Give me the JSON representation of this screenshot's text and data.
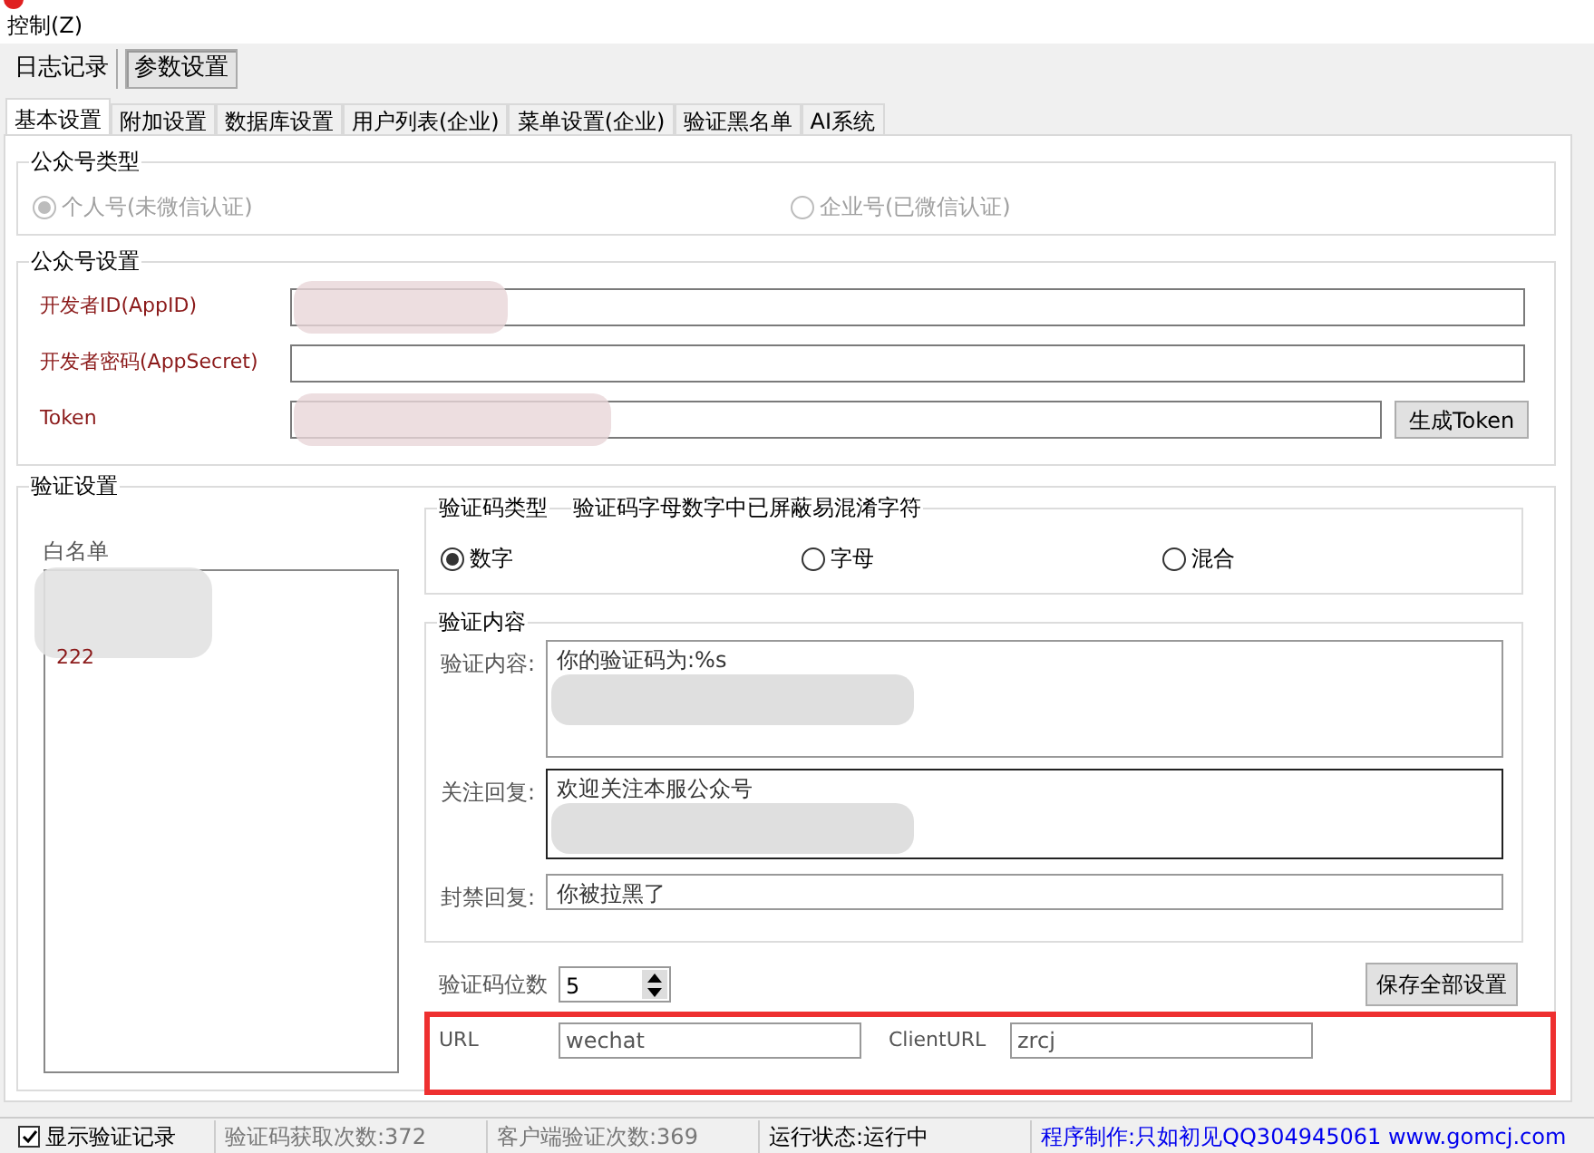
{
  "menu": [
    {
      "label": "控制(Z)"
    }
  ],
  "main_tabs": [
    {
      "label": "日志记录",
      "selected": false
    },
    {
      "label": "参数设置",
      "selected": true
    }
  ],
  "sub_tabs": [
    {
      "label": "基本设置",
      "selected": true
    },
    {
      "label": "附加设置",
      "selected": false
    },
    {
      "label": "数据库设置",
      "selected": false
    },
    {
      "label": "用户列表(企业)",
      "selected": false
    },
    {
      "label": "菜单设置(企业)",
      "selected": false
    },
    {
      "label": "验证黑名单",
      "selected": false
    },
    {
      "label": "AI系统",
      "selected": false
    }
  ],
  "account_type": {
    "title": "公众号类型",
    "disabled": true,
    "options": [
      {
        "label": "个人号(未微信认证)",
        "selected": true
      },
      {
        "label": "企业号(已微信认证)",
        "selected": false
      }
    ]
  },
  "account_settings": {
    "title": "公众号设置",
    "fields": [
      {
        "label": "开发者ID(AppID)",
        "redacted": true
      },
      {
        "label": "开发者密码(AppSecret)",
        "redacted": false
      },
      {
        "label": "Token",
        "redacted": true
      }
    ],
    "token_button": "生成Token"
  },
  "verify_settings": {
    "title": "验证设置",
    "whitelist_label": "白名单",
    "whitelist_items": [
      "222"
    ],
    "code_type": {
      "title": "验证码类型",
      "note": "验证码字母数字中已屏蔽易混淆字符",
      "options": [
        {
          "label": "数字",
          "selected": true
        },
        {
          "label": "字母",
          "selected": false
        },
        {
          "label": "混合",
          "selected": false
        }
      ]
    },
    "content": {
      "title": "验证内容",
      "rows": [
        {
          "label": "验证内容:",
          "value": "你的验证码为:%s",
          "multiline": true,
          "focused": false
        },
        {
          "label": "关注回复:",
          "value": "欢迎关注本服公众号",
          "multiline": true,
          "focused": true
        },
        {
          "label": "封禁回复:",
          "value": "你被拉黑了",
          "multiline": false,
          "focused": false
        }
      ]
    },
    "digits_label": "验证码位数",
    "digits_value": "5",
    "save_button": "保存全部设置",
    "url_label": "URL",
    "url_value": "wechat",
    "client_url_label": "ClientURL",
    "client_url_value": "zrcj"
  },
  "status_bar": {
    "show_log": {
      "label": "显示验证记录",
      "checked": true
    },
    "items": [
      {
        "text": "验证码获取次数:372",
        "kind": "grey"
      },
      {
        "text": "客户端验证次数:369",
        "kind": "grey"
      },
      {
        "text": "运行状态:运行中",
        "kind": "black"
      },
      {
        "text": "程序制作:只如初见QQ304945061 www.gomcj.com",
        "kind": "link"
      }
    ]
  }
}
